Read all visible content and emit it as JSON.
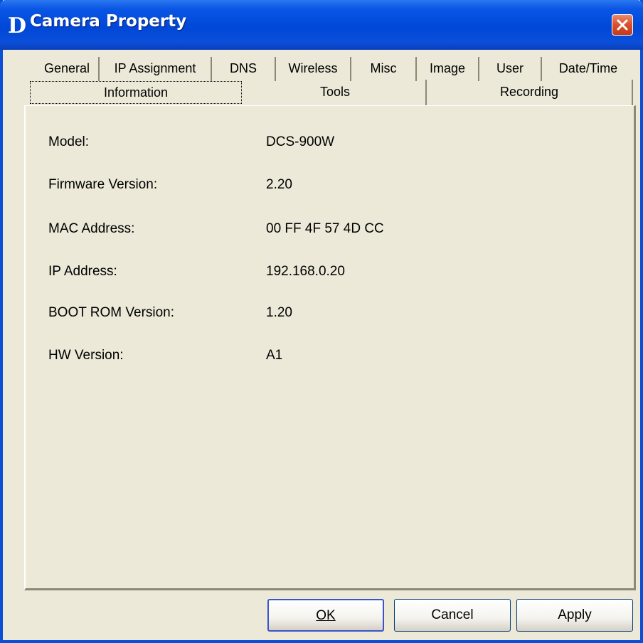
{
  "window": {
    "title": "Camera Property",
    "logo_letter": "D"
  },
  "tabs": {
    "row1": [
      "General",
      "IP Assignment",
      "DNS",
      "Wireless",
      "Misc",
      "Image",
      "User",
      "Date/Time"
    ],
    "row2": [
      "Information",
      "Tools",
      "Recording"
    ],
    "active": "Information"
  },
  "info": {
    "rows": [
      {
        "label": "Model:",
        "value": "DCS-900W"
      },
      {
        "label": "Firmware Version:",
        "value": "2.20"
      },
      {
        "label": "MAC Address:",
        "value": "00 FF 4F 57 4D CC"
      },
      {
        "label": "IP Address:",
        "value": "192.168.0.20"
      },
      {
        "label": "BOOT ROM Version:",
        "value": "1.20"
      },
      {
        "label": "HW Version:",
        "value": "A1"
      }
    ]
  },
  "buttons": {
    "ok": "OK",
    "cancel": "Cancel",
    "apply": "Apply"
  },
  "colors": {
    "titlebar": "#0047d8",
    "dialog_bg": "#ece9d8",
    "close_button": "#d9502b"
  },
  "icons": {
    "close": "close-icon",
    "logo": "dlink-logo-icon"
  }
}
